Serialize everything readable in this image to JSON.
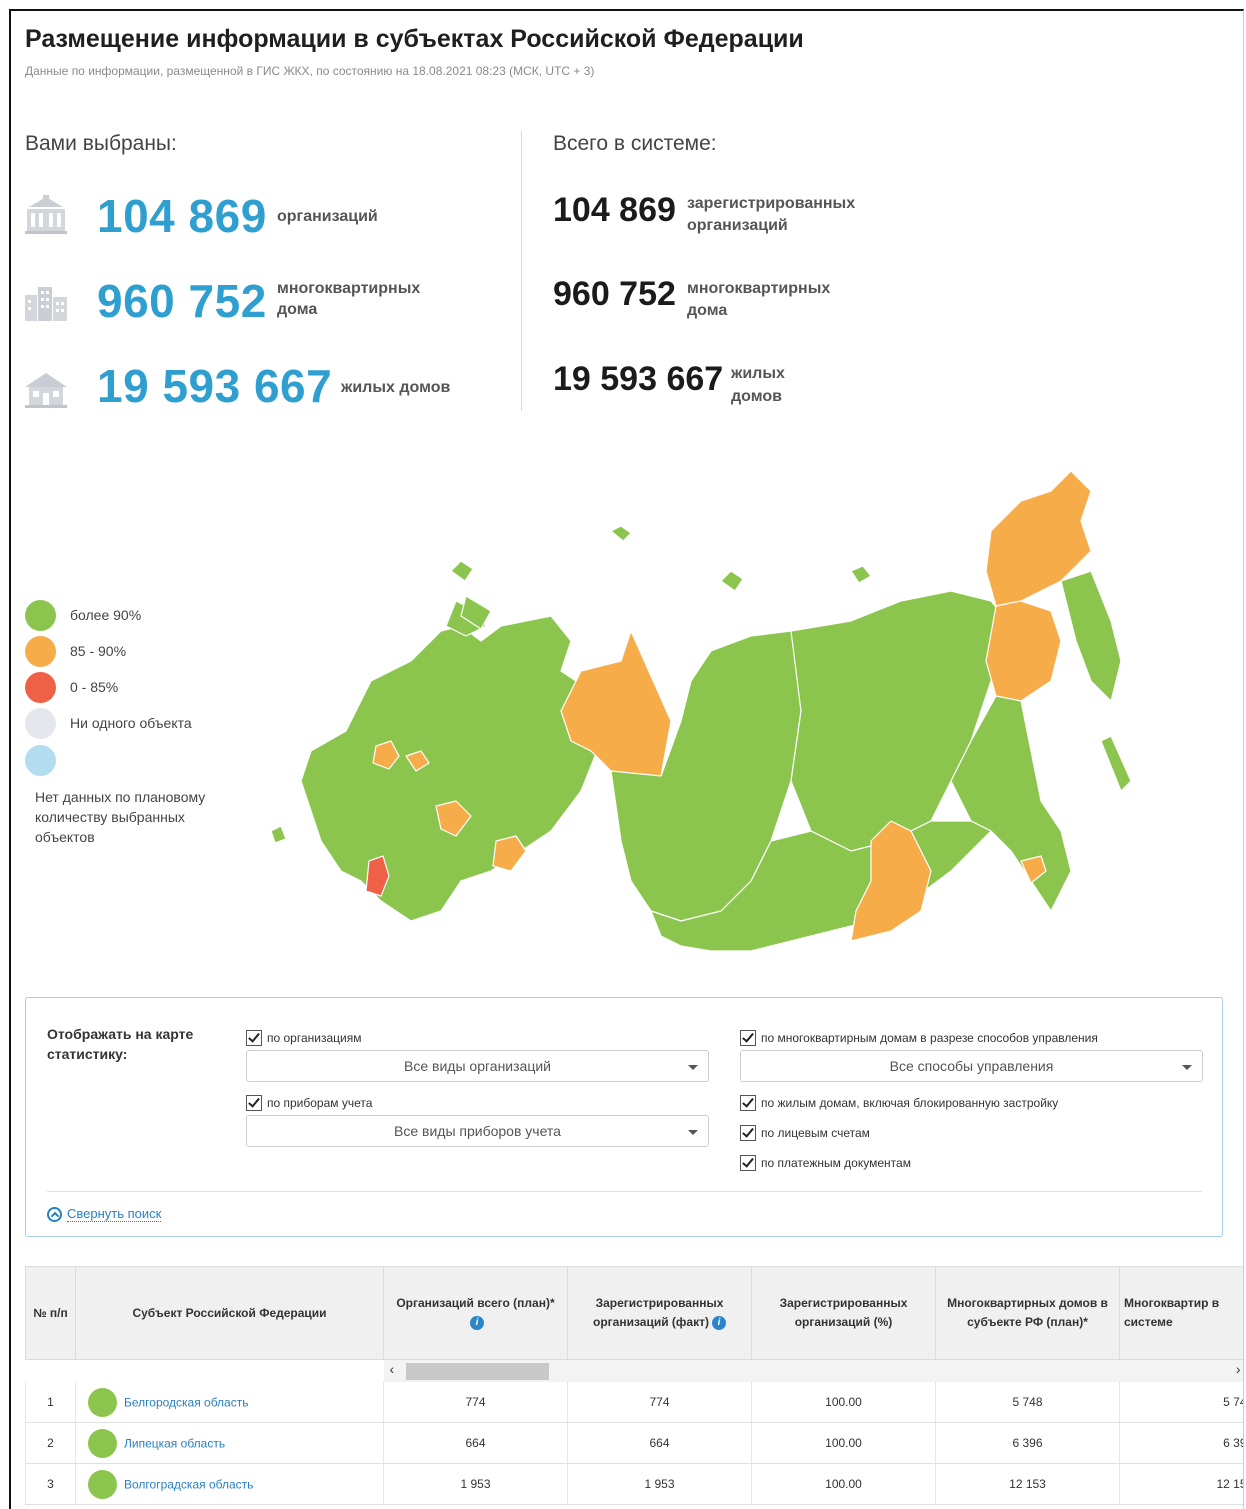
{
  "header": {
    "title": "Размещение информации в субъектах Российской Федерации",
    "subtitle": "Данные по информации, размещенной в ГИС ЖКХ, по состоянию на 18.08.2021 08:23 (МСК, UTC + 3)"
  },
  "selected": {
    "heading": "Вами выбраны:",
    "stats": [
      {
        "value": "104 869",
        "label": "организаций",
        "icon": "government-building-icon"
      },
      {
        "value": "960 752",
        "label_line1": "многоквартирных",
        "label_line2": "дома",
        "icon": "apartment-buildings-icon"
      },
      {
        "value": "19 593 667",
        "label": "жилых домов",
        "icon": "house-icon"
      }
    ]
  },
  "system": {
    "heading": "Всего в системе:",
    "stats": [
      {
        "value": "104 869",
        "label_line1": "зарегистрированных",
        "label_line2": "организаций"
      },
      {
        "value": "960 752",
        "label_line1": "многоквартирных",
        "label_line2": "дома"
      },
      {
        "value": "19 593 667",
        "label_line1": "жилых",
        "label_line2": "домов"
      }
    ]
  },
  "legend": {
    "items": [
      {
        "label": "более 90%",
        "color": "#8cc54e"
      },
      {
        "label": "85 - 90%",
        "color": "#f7ac4a"
      },
      {
        "label": "0 - 85%",
        "color": "#ee6147"
      },
      {
        "label": "Ни одного объекта",
        "color": "#e4e8ec"
      },
      {
        "label": "Нет данных по плановому количеству выбранных объектов",
        "color": "#b3dcf0"
      }
    ]
  },
  "filters": {
    "label": "Отображать на карте статистику:",
    "by_orgs": "по организациям",
    "orgs_select": "Все виды организаций",
    "by_meters": "по приборам учета",
    "meters_select": "Все виды приборов учета",
    "by_mkd": "по многоквартирным домам в разрезе способов управления",
    "mkd_select": "Все способы управления",
    "by_houses": "по жилым домам, включая блокированную застройку",
    "by_accounts": "по лицевым счетам",
    "by_payments": "по платежным документам",
    "collapse": "Свернуть поиск"
  },
  "table": {
    "headers": {
      "num": "№ п/п",
      "subject": "Субъект Российской Федерации",
      "orgs_plan": "Организаций всего (план)*",
      "orgs_fact": "Зарегистрированных организаций (факт)",
      "orgs_pct": "Зарегистрированных организаций (%)",
      "mkd_plan": "Многоквартирных домов в субъекте РФ (план)*",
      "mkd_sys": "Многоквартир в системе"
    },
    "rows": [
      {
        "num": "1",
        "region": "Белгородская область",
        "orgs_plan": "774",
        "orgs_fact": "774",
        "orgs_pct": "100.00",
        "mkd_plan": "5 748",
        "mkd_sys": "5 74"
      },
      {
        "num": "2",
        "region": "Липецкая область",
        "orgs_plan": "664",
        "orgs_fact": "664",
        "orgs_pct": "100.00",
        "mkd_plan": "6 396",
        "mkd_sys": "6 39"
      },
      {
        "num": "3",
        "region": "Волгоградская область",
        "orgs_plan": "1 953",
        "orgs_fact": "1 953",
        "orgs_pct": "100.00",
        "mkd_plan": "12 153",
        "mkd_sys": "12 15"
      }
    ]
  }
}
